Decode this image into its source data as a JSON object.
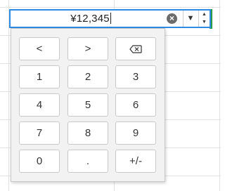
{
  "cell": {
    "value": "¥12,345",
    "clear_icon": "×",
    "dropdown_icon": "▼",
    "spin_up_icon": "▲",
    "spin_down_icon": "▼"
  },
  "keypad": {
    "row1": [
      "<",
      ">",
      "backspace-icon"
    ],
    "row2": [
      "1",
      "2",
      "3"
    ],
    "row3": [
      "4",
      "5",
      "6"
    ],
    "row4": [
      "7",
      "8",
      "9"
    ],
    "row5": [
      "0",
      ".",
      "+/-"
    ]
  },
  "colors": {
    "accent": "#2e8ae6",
    "green_marker": "#2a9a43"
  }
}
